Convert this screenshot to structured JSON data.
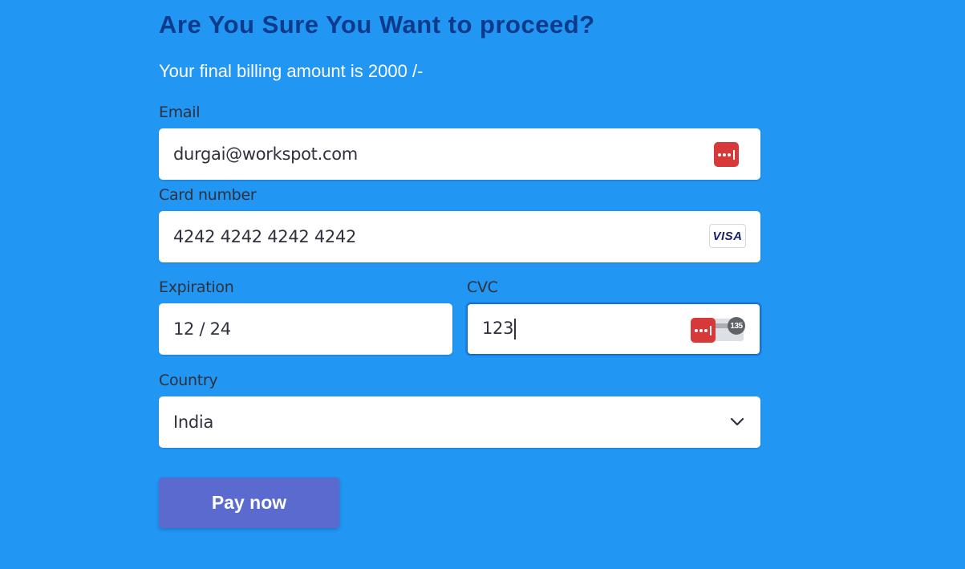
{
  "header": {
    "title": "Are You Sure You Want to proceed?",
    "subtitle": "Your final billing amount is 2000 /-"
  },
  "form": {
    "email": {
      "label": "Email",
      "value": "durgai@workspot.com",
      "icon": "password-manager-icon"
    },
    "card_number": {
      "label": "Card number",
      "value": "4242 4242 4242 4242",
      "brand": "VISA"
    },
    "expiration": {
      "label": "Expiration",
      "value": "12 / 24"
    },
    "cvc": {
      "label": "CVC",
      "value": "123",
      "badge": "135",
      "icon": "password-manager-icon"
    },
    "country": {
      "label": "Country",
      "value": "India",
      "icon": "chevron-down-icon"
    }
  },
  "actions": {
    "pay_label": "Pay now"
  },
  "colors": {
    "background": "#2196f3",
    "title": "#0d3a8a",
    "button": "#5a6acf",
    "password_manager": "#d7393a",
    "field_text": "#30313d"
  }
}
